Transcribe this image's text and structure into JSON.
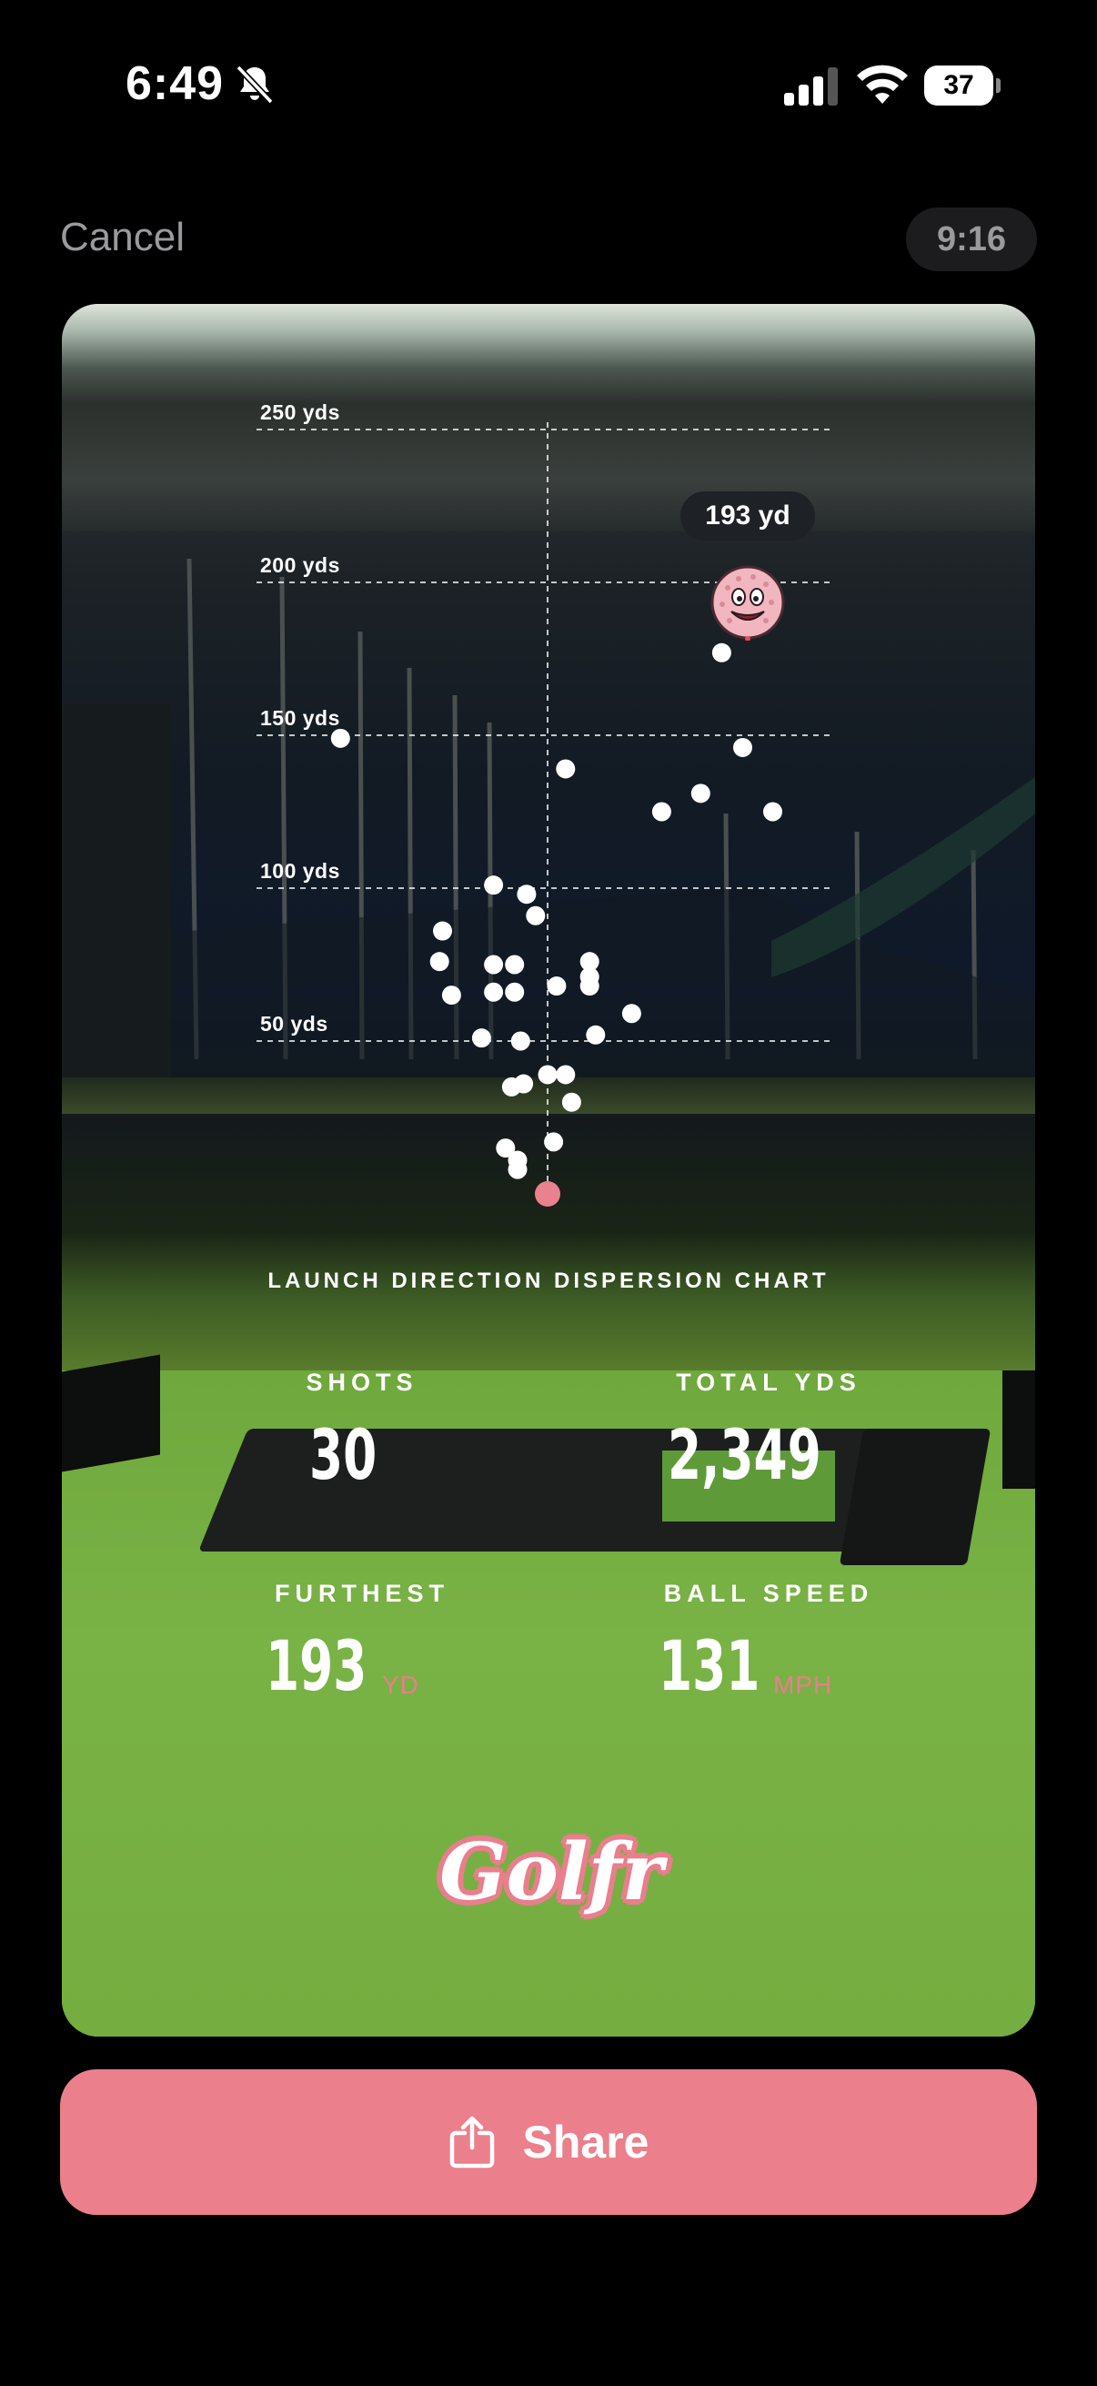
{
  "status_bar": {
    "time": "6:49",
    "battery": "37"
  },
  "header": {
    "cancel_label": "Cancel",
    "aspect_label": "9:16"
  },
  "chart_data": {
    "type": "scatter",
    "title": "LAUNCH DIRECTION DISPERSION CHART",
    "y_ticks": [
      "250 yds",
      "200 yds",
      "150 yds",
      "100 yds",
      "50 yds"
    ],
    "furthest_label": "193 yd",
    "points": [
      {
        "x": 0,
        "y": 0,
        "origin": true
      },
      {
        "x": -14,
        "y": 15
      },
      {
        "x": -10,
        "y": 11
      },
      {
        "x": -10,
        "y": 8
      },
      {
        "x": 2,
        "y": 17
      },
      {
        "x": 8,
        "y": 30
      },
      {
        "x": -12,
        "y": 35
      },
      {
        "x": -8,
        "y": 36
      },
      {
        "x": 0,
        "y": 39
      },
      {
        "x": 6,
        "y": 39
      },
      {
        "x": -22,
        "y": 51
      },
      {
        "x": -9,
        "y": 50
      },
      {
        "x": 16,
        "y": 52
      },
      {
        "x": 28,
        "y": 59
      },
      {
        "x": -32,
        "y": 65
      },
      {
        "x": -18,
        "y": 66
      },
      {
        "x": -11,
        "y": 66
      },
      {
        "x": 3,
        "y": 68
      },
      {
        "x": 14,
        "y": 68
      },
      {
        "x": -36,
        "y": 76
      },
      {
        "x": -18,
        "y": 75
      },
      {
        "x": -11,
        "y": 75
      },
      {
        "x": 14,
        "y": 71
      },
      {
        "x": -35,
        "y": 86
      },
      {
        "x": -4,
        "y": 91
      },
      {
        "x": 14,
        "y": 76
      },
      {
        "x": -7,
        "y": 98
      },
      {
        "x": -18,
        "y": 101
      },
      {
        "x": 38,
        "y": 125
      },
      {
        "x": 51,
        "y": 131
      },
      {
        "x": 75,
        "y": 125
      },
      {
        "x": 65,
        "y": 146
      },
      {
        "x": -69,
        "y": 149
      },
      {
        "x": 6,
        "y": 139
      },
      {
        "x": 58,
        "y": 177
      }
    ]
  },
  "stats": {
    "shots_label": "SHOTS",
    "shots_value": "30",
    "total_label": "TOTAL YDS",
    "total_value": "2,349",
    "furthest_label": "FURTHEST",
    "furthest_value": "193",
    "furthest_unit": "YD",
    "speed_label": "BALL SPEED",
    "speed_value": "131",
    "speed_unit": "MPH"
  },
  "brand": {
    "logo_text": "Golfr"
  },
  "share": {
    "label": "Share",
    "icon": "share-icon"
  },
  "colors": {
    "accent": "#ec7f8c",
    "origin_dot": "#e9828e"
  }
}
